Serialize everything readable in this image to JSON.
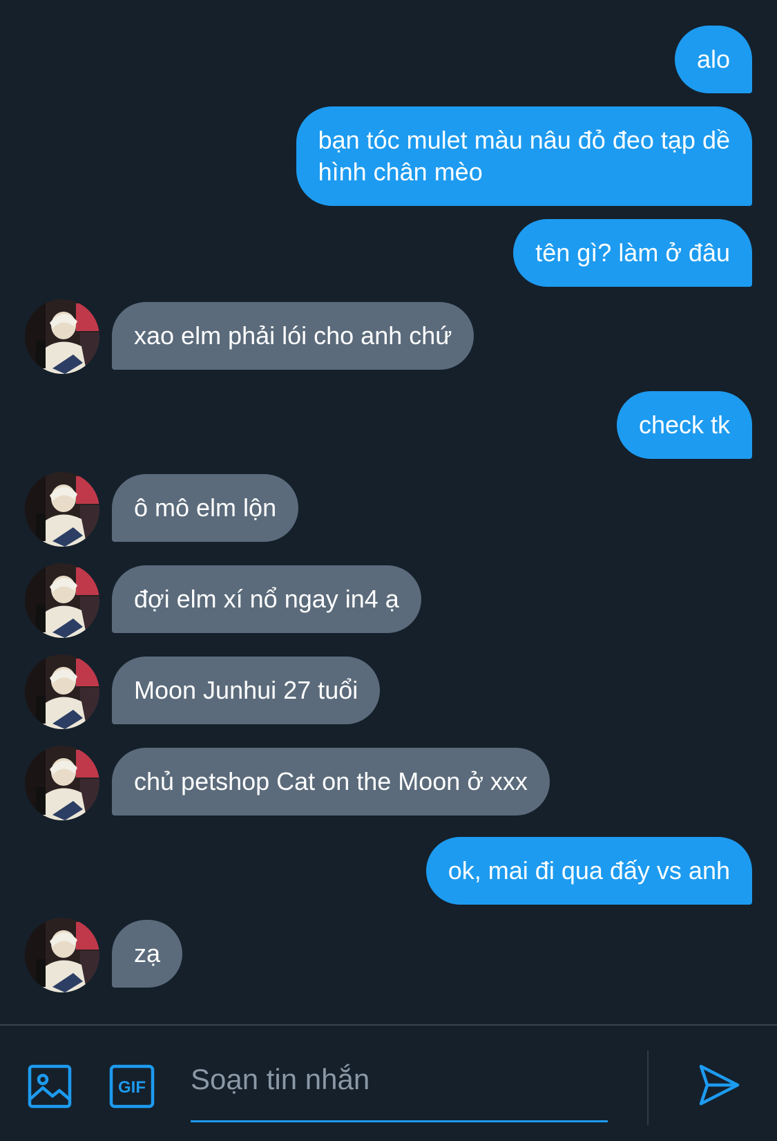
{
  "conversation": {
    "messages": [
      {
        "direction": "outgoing",
        "text": "alo"
      },
      {
        "direction": "outgoing",
        "text": "bạn tóc mulet màu nâu đỏ đeo tạp dề\nhình chân mèo"
      },
      {
        "direction": "outgoing",
        "text": "tên gì? làm ở đâu"
      },
      {
        "direction": "incoming",
        "text": "xao elm phải lói cho anh chứ"
      },
      {
        "direction": "outgoing",
        "text": "check tk"
      },
      {
        "direction": "incoming",
        "text": "ô mô elm lộn"
      },
      {
        "direction": "incoming",
        "text": "đợi elm xí nổ ngay in4 ạ"
      },
      {
        "direction": "incoming",
        "text": "Moon Junhui 27 tuổi"
      },
      {
        "direction": "incoming",
        "text": "chủ petshop Cat on the Moon ở xxx"
      },
      {
        "direction": "outgoing",
        "text": "ok, mai đi qua đấy vs anh"
      },
      {
        "direction": "incoming",
        "text": "zạ"
      }
    ]
  },
  "composer": {
    "placeholder": "Soạn tin nhắn",
    "gif_label": "GIF",
    "icons": [
      "image-icon",
      "gif-icon",
      "send-icon"
    ]
  },
  "colors": {
    "background": "#15202b",
    "outgoing_bubble": "#1d9bf0",
    "incoming_bubble": "#5b6b7b",
    "accent": "#1d9bf0",
    "placeholder": "#8b98a5"
  }
}
